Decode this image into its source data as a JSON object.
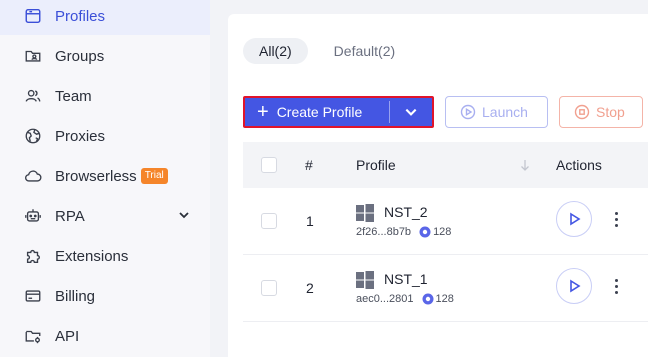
{
  "sidebar": {
    "items": [
      {
        "label": "Profiles",
        "icon": "window-icon"
      },
      {
        "label": "Groups",
        "icon": "folder-user-icon"
      },
      {
        "label": "Team",
        "icon": "team-icon"
      },
      {
        "label": "Proxies",
        "icon": "globe-icon"
      },
      {
        "label": "Browserless",
        "icon": "cloud-icon",
        "badge": "Trial"
      },
      {
        "label": "RPA",
        "icon": "robot-icon"
      },
      {
        "label": "Extensions",
        "icon": "puzzle-icon"
      },
      {
        "label": "Billing",
        "icon": "card-icon"
      },
      {
        "label": "API",
        "icon": "api-folder-icon"
      }
    ]
  },
  "tabs": [
    {
      "label": "All(2)"
    },
    {
      "label": "Default(2)"
    }
  ],
  "toolbar": {
    "create_label": "Create Profile",
    "launch_label": "Launch",
    "stop_label": "Stop"
  },
  "table": {
    "headers": {
      "num": "#",
      "profile": "Profile",
      "actions": "Actions"
    },
    "rows": [
      {
        "num": "1",
        "name": "NST_2",
        "id": "2f26...8b7b",
        "kernel": "128"
      },
      {
        "num": "2",
        "name": "NST_1",
        "id": "aec0...2801",
        "kernel": "128"
      }
    ]
  },
  "colors": {
    "accent": "#4456e3",
    "active_bg": "#ebeefc",
    "trial_badge": "#f5852a",
    "highlight_border": "#e0142b",
    "stop": "#f1a08f"
  }
}
